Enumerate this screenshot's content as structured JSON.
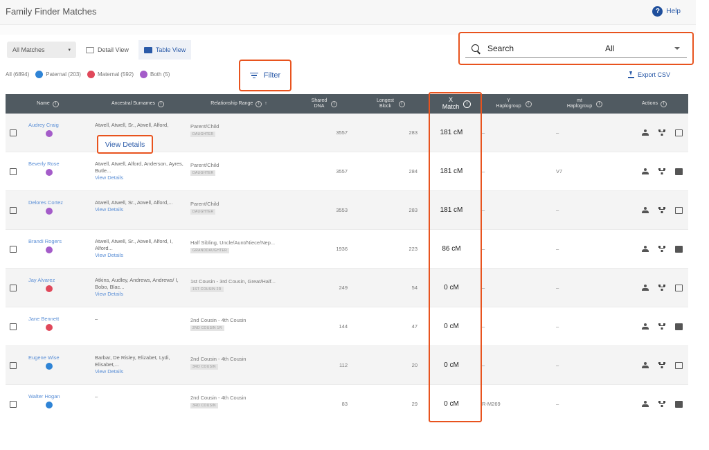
{
  "header": {
    "title": "Family Finder Matches",
    "help_label": "Help",
    "help_icon": "?"
  },
  "toolbar": {
    "all_matches_label": "All Matches",
    "detail_view_label": "Detail View",
    "table_view_label": "Table View",
    "filter_label": "Filter",
    "export_label": "Export CSV"
  },
  "filters": {
    "all_label": "All (6894)",
    "paternal_label": "Paternal (203)",
    "maternal_label": "Maternal (592)",
    "both_label": "Both (5)"
  },
  "search": {
    "label": "Search",
    "select_value": "All"
  },
  "table": {
    "headers": {
      "name": "Name",
      "surnames": "Ancestral Surnames",
      "relationship": "Relationship Range",
      "shared": "Shared DNA",
      "longest": "Longest Block",
      "x_match": "X Match",
      "y_haplo": "Y Haplogroup",
      "mt_haplo": "mt Haplogroup",
      "actions": "Actions"
    },
    "view_details_label": "View Details",
    "rows": [
      {
        "name": "Audrey Craig",
        "side": "both",
        "surnames": "Atwell, Atwell, Sr., Atwell, Alford,",
        "view_details": "",
        "relationship": "Parent/Child",
        "rel_tag": "DAUGHTER",
        "shared": "3557",
        "longest": "283",
        "x_match": "181 cM",
        "y": "–",
        "mt": "–"
      },
      {
        "name": "Beverly Rose",
        "side": "both",
        "surnames": "Atwell, Atwell, Alford, Anderson, Ayres, Butle...",
        "view_details": "View Details",
        "relationship": "Parent/Child",
        "rel_tag": "DAUGHTER",
        "shared": "3557",
        "longest": "284",
        "x_match": "181 cM",
        "y": "–",
        "mt": "V7"
      },
      {
        "name": "Delores Cortez",
        "side": "both",
        "surnames": "Atwell, Atwell, Sr., Atwell, Alford,...",
        "view_details": "View Details",
        "relationship": "Parent/Child",
        "rel_tag": "DAUGHTER",
        "shared": "3553",
        "longest": "283",
        "x_match": "181 cM",
        "y": "–",
        "mt": "–"
      },
      {
        "name": "Brandi Rogers",
        "side": "both",
        "surnames": "Atwell, Atwell, Sr., Atwell, Alford, I, Alford...",
        "view_details": "View Details",
        "relationship": "Half Sibling, Uncle/Aunt/Niece/Nep...",
        "rel_tag": "GRANDDAUGHTER",
        "shared": "1936",
        "longest": "223",
        "x_match": "86 cM",
        "y": "–",
        "mt": "–"
      },
      {
        "name": "Jay Alvarez",
        "side": "maternal",
        "surnames": "Atkins, Audley, Andrews, Andrews/ I, Bobo, Blac...",
        "view_details": "View Details",
        "relationship": "1st Cousin - 3rd Cousin, Great/Half...",
        "rel_tag": "1ST COUSIN 2R",
        "shared": "249",
        "longest": "54",
        "x_match": "0 cM",
        "y": "–",
        "mt": "–"
      },
      {
        "name": "Jane Bennett",
        "side": "maternal",
        "surnames": "–",
        "view_details": "",
        "relationship": "2nd Cousin - 4th Cousin",
        "rel_tag": "2ND COUSIN 1R",
        "shared": "144",
        "longest": "47",
        "x_match": "0 cM",
        "y": "–",
        "mt": "–"
      },
      {
        "name": "Eugene Wise",
        "side": "paternal",
        "surnames": "Barbar, De Risley, Elizabet, Lydi, Elisabet,...",
        "view_details": "View Details",
        "relationship": "2nd Cousin - 4th Cousin",
        "rel_tag": "3RD COUSIN",
        "shared": "112",
        "longest": "20",
        "x_match": "0 cM",
        "y": "–",
        "mt": "–"
      },
      {
        "name": "Walter Hogan",
        "side": "paternal",
        "surnames": "–",
        "view_details": "",
        "relationship": "2nd Cousin - 4th Cousin",
        "rel_tag": "3RD COUSIN",
        "shared": "83",
        "longest": "29",
        "x_match": "0 cM",
        "y": "R-M269",
        "mt": "–"
      }
    ]
  },
  "colors": {
    "accent": "#2a5aa8",
    "highlight": "#e8531e",
    "header_bg": "#505a61",
    "paternal": "#2f84d6",
    "maternal": "#e0485a",
    "both": "#a45cc9"
  },
  "icons": {
    "person": "person-icon",
    "tree": "family-tree-icon",
    "message": "message-icon",
    "info": "info-icon"
  }
}
